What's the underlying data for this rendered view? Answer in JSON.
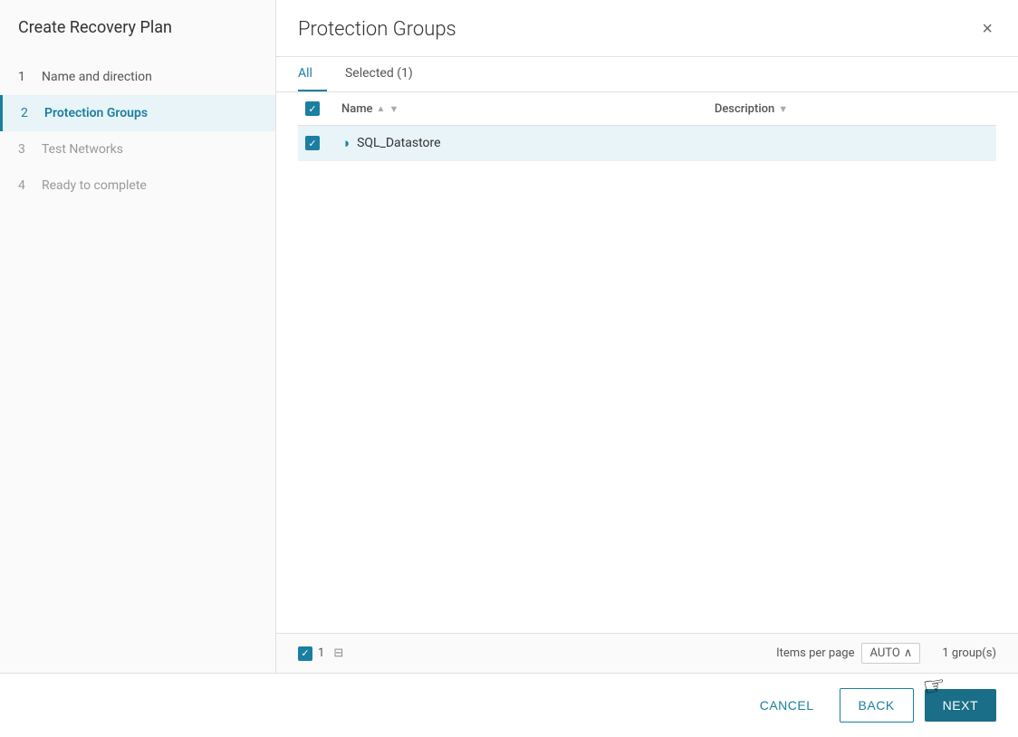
{
  "sidebar": {
    "title": "Create Recovery Plan",
    "steps": [
      {
        "number": "1",
        "label": "Name and direction",
        "state": "completed"
      },
      {
        "number": "2",
        "label": "Protection Groups",
        "state": "active"
      },
      {
        "number": "3",
        "label": "Test Networks",
        "state": "pending"
      },
      {
        "number": "4",
        "label": "Ready to complete",
        "state": "pending"
      }
    ]
  },
  "panel": {
    "title": "Protection Groups",
    "close_label": "×"
  },
  "tabs": [
    {
      "label": "All",
      "state": "active"
    },
    {
      "label": "Selected (1)",
      "state": "inactive"
    }
  ],
  "table": {
    "columns": [
      {
        "label": "Name"
      },
      {
        "label": "Description"
      }
    ],
    "rows": [
      {
        "name": "SQL_Datastore",
        "description": "",
        "selected": true
      }
    ]
  },
  "footer": {
    "selected_count": "1",
    "items_per_page_label": "Items per page",
    "page_size": "AUTO",
    "groups_count": "1 group(s)"
  },
  "actions": {
    "cancel_label": "CANCEL",
    "back_label": "BACK",
    "next_label": "NEXT"
  }
}
